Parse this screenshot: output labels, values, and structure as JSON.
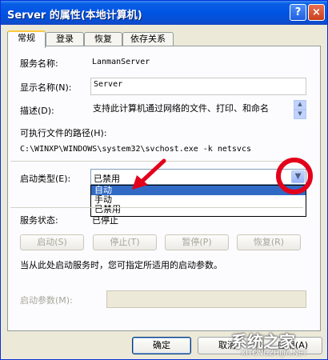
{
  "window": {
    "title": "Server 的属性(本地计算机)",
    "help_glyph": "?",
    "close_glyph": "×"
  },
  "tabs": [
    {
      "label": "常规"
    },
    {
      "label": "登录"
    },
    {
      "label": "恢复"
    },
    {
      "label": "依存关系"
    }
  ],
  "general": {
    "service_name_label": "服务名称:",
    "service_name_value": "LanmanServer",
    "display_name_label": "显示名称(N):",
    "display_name_value": "Server",
    "description_label": "描述(D):",
    "description_value": "支持此计算机通过网络的文件、打印、和命名",
    "exe_path_label": "可执行文件的路径(H):",
    "exe_path_value": "C:\\WINXP\\WINDOWS\\system32\\svchost.exe -k netsvcs",
    "startup_type_label": "启动类型(E):",
    "startup_type_value": "已禁用",
    "startup_options": [
      "自动",
      "手动",
      "已禁用"
    ],
    "status_label": "服务状态:",
    "status_value": "已停止",
    "buttons": {
      "start": "启动(S)",
      "stop": "停止(T)",
      "pause": "暂停(P)",
      "resume": "恢复(R)"
    },
    "hint": "当从此处启动服务时，您可指定所适用的启动参数。",
    "params_label": "启动参数(M):",
    "params_value": ""
  },
  "footer": {
    "ok": "确定",
    "cancel": "取消",
    "apply": "应用(A)"
  },
  "watermark": {
    "text": "系统之家",
    "url": "XITONGZHIJIA.NET"
  },
  "colors": {
    "titlebar": "#0054e3",
    "highlight": "#316ac5",
    "annotation": "#e3001b"
  }
}
